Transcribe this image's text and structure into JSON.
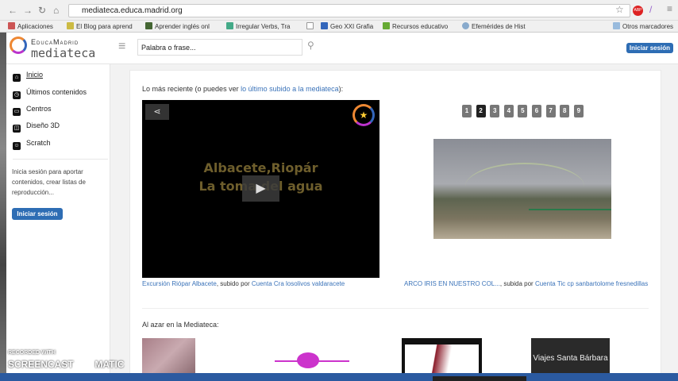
{
  "browser": {
    "url": "mediateca.educa.madrid.org",
    "bookmarks": [
      "Aplicaciones",
      "El Blog para aprend",
      "Aprender inglés onl",
      "Irregular Verbs, Tra",
      "",
      "Geo XXI Grafia",
      "Recursos educativo",
      "Efemérides de Hist"
    ],
    "other_bookmarks": "Otros marcadores",
    "adblock": "ABP"
  },
  "header": {
    "logo_top": "EducaMadrid",
    "logo_bottom": "mediateca",
    "search_placeholder": "Palabra o frase...",
    "login": "Iniciar sesión"
  },
  "sidebar": {
    "items": [
      {
        "label": "Inicio",
        "icon": "home-icon"
      },
      {
        "label": "Últimos contenidos",
        "icon": "clock-icon"
      },
      {
        "label": "Centros",
        "icon": "folder-icon"
      },
      {
        "label": "Diseño 3D",
        "icon": "cube-icon"
      },
      {
        "label": "Scratch",
        "icon": "cat-icon"
      }
    ],
    "info": "Inicia sesión para aportar contenidos, crear listas de reproducción...",
    "login": "Iniciar sesión"
  },
  "main": {
    "recent_prefix": "Lo más reciente (o puedes ver ",
    "recent_link": "lo último subido a la mediateca",
    "recent_suffix": "):",
    "video": {
      "line1": "Albacete,Riopár",
      "line2": "La toma del agua"
    },
    "pages": [
      "1",
      "2",
      "3",
      "4",
      "5",
      "6",
      "7",
      "8",
      "9"
    ],
    "active_page": "2",
    "caption1": {
      "title": "Excursión Riópar Albacete",
      "by": ", subido por ",
      "user": "Cuenta Cra losolivos valdaracete"
    },
    "caption2": {
      "title": "ARCO IRIS EN NUESTRO COL...",
      "by": ", subida por ",
      "user": "Cuenta Tic cp sanbartolome fresnedillas"
    },
    "random_title": "Al azar en la Mediateca:",
    "thumb4_text": "Viajes Santa Bárbara"
  },
  "watermark": {
    "top": "RECORDED WITH",
    "bottom": "SCREENCAST",
    "suffix": "MATIC"
  }
}
